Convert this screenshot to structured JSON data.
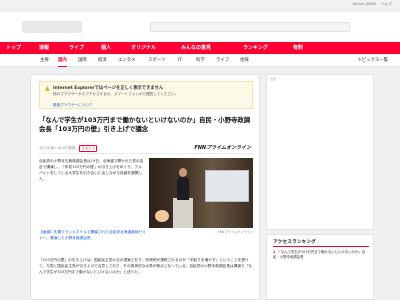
{
  "header": {
    "top_links": [
      "Yahoo! JAPAN",
      "ヘルプ"
    ]
  },
  "main_nav": [
    {
      "label": "トップ",
      "active": false
    },
    {
      "label": "速報",
      "active": false
    },
    {
      "label": "ライブ",
      "active": false
    },
    {
      "label": "個人",
      "active": false
    },
    {
      "label": "オリジナル",
      "active": false
    },
    {
      "label": "みんなの意見",
      "active": false
    },
    {
      "label": "ランキング",
      "active": false
    },
    {
      "label": "有料",
      "active": false
    }
  ],
  "categories": [
    {
      "label": "主要",
      "active": false
    },
    {
      "label": "国内",
      "active": true
    },
    {
      "label": "国際",
      "active": false
    },
    {
      "label": "経済",
      "active": false
    },
    {
      "label": "エンタメ",
      "active": false
    },
    {
      "label": "スポーツ",
      "active": false
    },
    {
      "label": "IT",
      "active": false
    },
    {
      "label": "科学",
      "active": false
    },
    {
      "label": "ライフ",
      "active": false
    },
    {
      "label": "地域",
      "active": false
    }
  ],
  "topics_link": "トピックス一覧",
  "warning": {
    "title": "Internet Explorerではページを正しく表示できません",
    "text": "他のブラウザーからアクセスするか、スマートフォンから閲覧してください。",
    "link": "推奨ブラウザーについて"
  },
  "article": {
    "headline": "「なんで学生が103万円まで働かないといけないのか」自民・小野寺政調会長「103万円の壁」引き上げで議念",
    "meta": "12/19(木) 19:47 配信",
    "comments": "コメント",
    "source": "FNNプライムオンライン",
    "body1": "自民党の小野寺五典政調会長は19日、北海道で開かれた党の会合で講演し、「年収103万円の壁」の引き上げをめぐり、アルバイトをしている大学生を引き合いに出しながら持論を展開した。",
    "photo_caption": "FNNプライムオンライン",
    "blue_link": "【画像】札幌グランドホテルで開催された自民党北海道政経セミナー。講演した小野寺政調会長",
    "body2": "「103万円の壁」の引き上げは、国民民主党の元の提案どおり、所得税が課税されるのが「手取りを増やす」ということを受けて、与党と国民民主党が引き上げで合意しており、その具体的な水準が焦点となっている。自民党の小野寺政調会長は講演で「なんで学生が103万円まで働かないといけないのか」と述べた。"
  },
  "sidebar": {
    "ad_label": "広告",
    "ranking_title": "アクセスランキング",
    "ranking_items": [
      {
        "num": "1",
        "text": "「なんで学生が103万円まで働かないといけないのか」自民・小野寺政調会長"
      }
    ]
  }
}
